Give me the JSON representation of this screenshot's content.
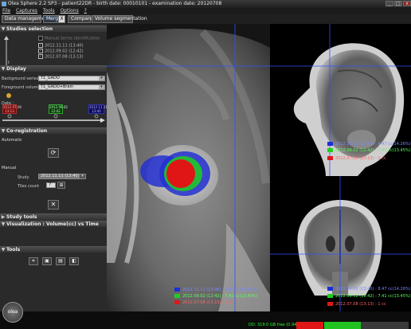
{
  "window": {
    "title": "Olea Sphere 2.2 SP3 - patient22DR - birth date: 00010101 - examination date: 20120708",
    "minimize": "_",
    "maximize": "□",
    "close": "x"
  },
  "menu": [
    "File",
    "Captures",
    "Tools",
    "Options",
    "?"
  ],
  "toolbar": {
    "data_management": "Data management",
    "merge": "Merge",
    "merge_close": "X",
    "compare": "Compare",
    "volume_segmentation": "Volume segmentation"
  },
  "studies_selection": {
    "title": "Studies selection",
    "manual_identification": "Manual Series Identification",
    "studies": [
      "2012.11.11 (13:40)",
      "2012.09.02 (12:42)",
      "2012.07.08 (13:13)"
    ]
  },
  "display": {
    "title": "Display",
    "background_label": "Background series",
    "background_value": "T1_GADO",
    "foreground_label": "Foreground volume",
    "foreground_value": "T1_GADO+Brain",
    "date_label": "Date :",
    "dates": [
      {
        "date": "2012.07.08",
        "time": "13:13"
      },
      {
        "date": "2012.09.02",
        "time": "12:42"
      },
      {
        "date": "2012.11.11",
        "time": "13:40"
      }
    ],
    "axis_label": "t"
  },
  "coregistration": {
    "title": "Co-registration",
    "automatic": "Automatic",
    "manual": "Manual",
    "study_label": "Study",
    "study_value": "2012.11.11 (13:40)",
    "tiles_label": "Tiles count",
    "tiles_value": "7"
  },
  "study_tools": {
    "title": "Study tools"
  },
  "visualization": {
    "title": "Visualization : Volume(cc) vs Time"
  },
  "tools": {
    "title": "Tools"
  },
  "legend_main": [
    {
      "label": "2012.11.11 (13:40) : 8.47 cc(14.26%)",
      "color": "#1a2fd6"
    },
    {
      "label": "2012.09.02 (12:42) : 7.41 cc(13.45%)",
      "color": "#1fcf1f"
    },
    {
      "label": "2012.07.08 (13:13) : 1 cc",
      "color": "#e01616"
    }
  ],
  "legend_top": [
    {
      "label": "2012.11.11 (13:40) : 8.47 cc(14.26%)",
      "color": "#1a2fd6"
    },
    {
      "label": "2012.09.02 (12:42) : 7.41 cc(13.45%)",
      "color": "#1fcf1f"
    },
    {
      "label": "2012.07.08 (13:13) : 1 cc",
      "color": "#e01616"
    }
  ],
  "legend_bottom": [
    {
      "label": "2012.11.11 (13:40) : 8.47 cc(14.26%)",
      "color": "#1a2fd6"
    },
    {
      "label": "2012.09.02 (12:42) : 7.41 cc(13.45%)",
      "color": "#1fcf1f"
    },
    {
      "label": "2012.07.08 (13:13) : 1 cc",
      "color": "#e01616"
    }
  ],
  "status": {
    "logo": "olea",
    "disk": "DD: 319.0 GB free (0.94 %)"
  },
  "colors": {
    "accent_blue": "#1a2fd6",
    "accent_green": "#1fcf1f",
    "accent_red": "#e01616"
  }
}
